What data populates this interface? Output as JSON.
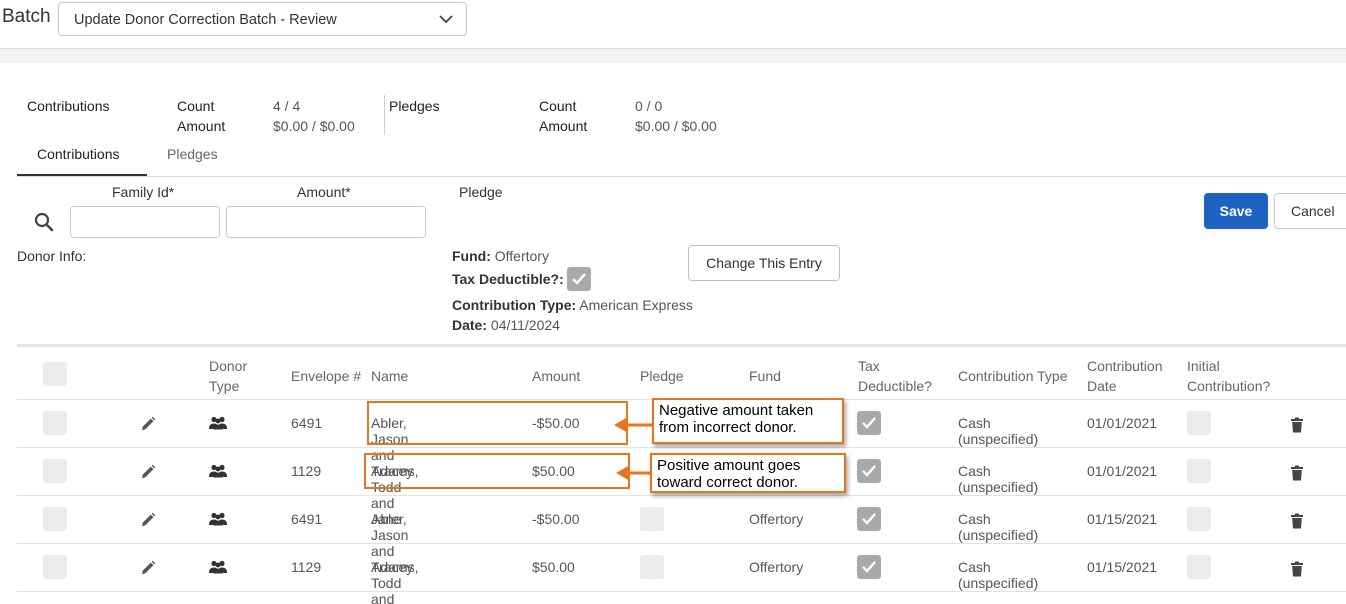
{
  "header": {
    "batch_label": "Batch",
    "batch_value": "Update Donor Correction Batch - Review"
  },
  "summary": {
    "contributions_label": "Contributions",
    "contrib_count_label": "Count",
    "contrib_count_value": "4 / 4",
    "contrib_amount_label": "Amount",
    "contrib_amount_value": "$0.00 / $0.00",
    "pledges_label": "Pledges",
    "pledge_count_label": "Count",
    "pledge_count_value": "0 / 0",
    "pledge_amount_label": "Amount",
    "pledge_amount_value": "$0.00 / $0.00"
  },
  "tabs": [
    {
      "label": "Contributions",
      "active": true
    },
    {
      "label": "Pledges",
      "active": false
    }
  ],
  "form": {
    "family_id_label": "Family Id*",
    "amount_label": "Amount*",
    "pledge_label": "Pledge",
    "save_label": "Save",
    "cancel_label": "Cancel",
    "donor_info_label": "Donor Info:",
    "fund_label": "Fund:",
    "fund_value": "Offertory",
    "tax_label": "Tax Deductible?:",
    "tax_checked": true,
    "contribution_type_label": "Contribution Type:",
    "contribution_type_value": "American Express",
    "date_label": "Date:",
    "date_value": "04/11/2024",
    "change_entry_label": "Change This Entry"
  },
  "table": {
    "headers": {
      "donor_type_1": "Donor",
      "donor_type_2": "Type",
      "envelope": "Envelope #",
      "name": "Name",
      "amount": "Amount",
      "pledge": "Pledge",
      "fund": "Fund",
      "tax_1": "Tax",
      "tax_2": "Deductible?",
      "contribution_type": "Contribution Type",
      "contribution_date_1": "Contribution",
      "contribution_date_2": "Date",
      "initial_1": "Initial",
      "initial_2": "Contribution?"
    },
    "rows": [
      {
        "envelope": "6491",
        "name": "Abler, Jason and Tracey",
        "amount": "-$50.00",
        "fund": "",
        "tax_deductible": true,
        "contribution_type": "Cash (unspecified)",
        "date": "01/01/2021"
      },
      {
        "envelope": "1129",
        "name": "Adams, Todd and Jane",
        "amount": "$50.00",
        "fund": "",
        "tax_deductible": true,
        "contribution_type": "Cash (unspecified)",
        "date": "01/01/2021"
      },
      {
        "envelope": "6491",
        "name": "Abler, Jason and Tracey",
        "amount": "-$50.00",
        "fund": "Offertory",
        "tax_deductible": true,
        "contribution_type": "Cash (unspecified)",
        "date": "01/15/2021"
      },
      {
        "envelope": "1129",
        "name": "Adams, Todd and Jane",
        "amount": "$50.00",
        "fund": "Offertory",
        "tax_deductible": true,
        "contribution_type": "Cash (unspecified)",
        "date": "01/15/2021"
      }
    ]
  },
  "annotations": {
    "callout_1_line1": "Negative amount taken",
    "callout_1_line2": "from incorrect donor.",
    "callout_2_line1": "Positive amount goes",
    "callout_2_line2": "toward correct donor.",
    "accent_color": "#e8741c"
  },
  "colors": {
    "primary": "#1e63c4",
    "checkbox_checked": "#a9a9a9"
  }
}
